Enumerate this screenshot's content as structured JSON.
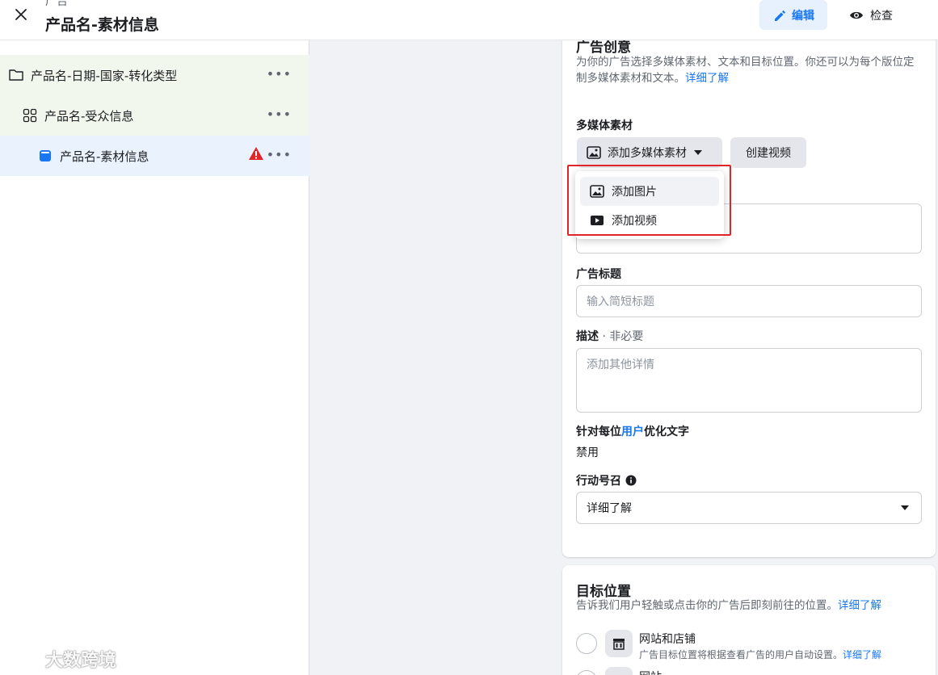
{
  "header": {
    "supertitle": "广告",
    "title": "产品名-素材信息",
    "edit_label": "编辑",
    "inspect_label": "检查"
  },
  "tree": {
    "campaign": "产品名-日期-国家-转化类型",
    "adset": "产品名-受众信息",
    "ad": "产品名-素材信息",
    "more": "•••"
  },
  "creative": {
    "title": "广告创意",
    "desc": "为你的广告选择多媒体素材、文本和目标位置。你还可以为每个版位定制多媒体素材和文本。",
    "desc_link": "详细了解",
    "media_label": "多媒体素材",
    "add_media_button": "添加多媒体素材",
    "create_video_button": "创建视频",
    "menu": {
      "add_image": "添加图片",
      "add_video": "添加视频"
    },
    "headline_label": "广告标题",
    "headline_placeholder": "输入简短标题",
    "description_label": "描述",
    "description_optional": " · 非必要",
    "description_placeholder": "添加其他详情",
    "optimize_label_a": "针对每位",
    "optimize_label_link": "用户",
    "optimize_label_b": "优化文字",
    "optimize_value": "禁用",
    "cta_label": "行动号召",
    "cta_value": "详细了解"
  },
  "destination": {
    "title": "目标位置",
    "desc": "告诉我们用户轻触或点击你的广告后即刻前往的位置。",
    "desc_link": "详细了解",
    "option1_title": "网站和店铺",
    "option1_desc": "广告目标位置将根据查看广告的用户自动设置。",
    "option1_link": "详细了解",
    "option2_title": "网站"
  },
  "watermark": "大数跨境",
  "colors": {
    "brand_blue": "#1877f2",
    "warning_red": "#e0242a",
    "tree_group_bg": "#f1f7ec",
    "selected_bg": "#eaf3fd"
  }
}
